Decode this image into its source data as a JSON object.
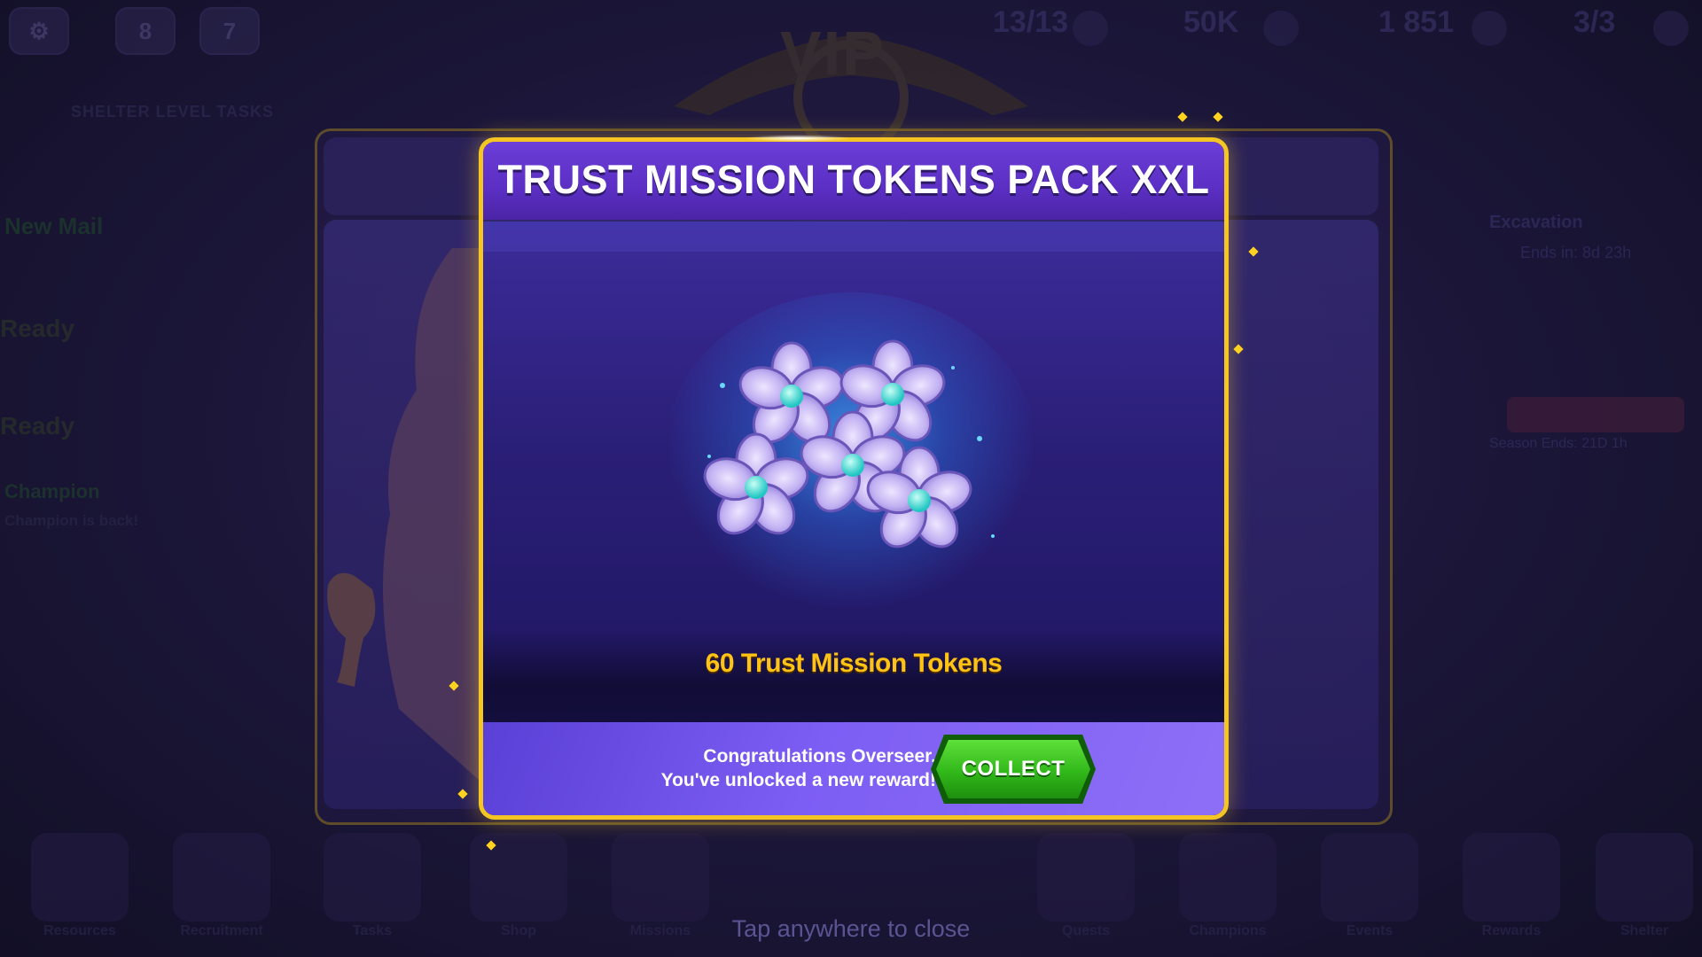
{
  "topbar": {
    "badge_a": "8",
    "badge_b": "7",
    "energy": "13/13",
    "caps": "50K",
    "gems": "1 851",
    "tickets": "3/3"
  },
  "vip": {
    "label": "VIP"
  },
  "left_panel": {
    "title": "SHELTER LEVEL TASKS",
    "new_mail": "New Mail",
    "ready_1": "Ready",
    "ready_2": "Ready",
    "champion": "Champion",
    "champion_sub": "Champion is back!"
  },
  "right_panel": {
    "title": "Excavation",
    "ends_in": "Ends in: 8d 23h",
    "season_ends": "Season Ends: 21D 1h"
  },
  "modal": {
    "title": "TRUST MISSION TOKENS PACK XXL",
    "reward_amount": "60 Trust Mission Tokens",
    "congrats_line1": "Congratulations Overseer,",
    "congrats_line2": "You've unlocked a new reward!",
    "collect_label": "COLLECT",
    "reward_icon": "flower-token-icon"
  },
  "bottom_nav": {
    "items": [
      "Resources",
      "Recruitment",
      "Tasks",
      "Shop",
      "Missions",
      "Quests",
      "Champions",
      "Events",
      "Rewards",
      "Shelter"
    ]
  },
  "close_hint": "Tap anywhere to close",
  "colors": {
    "accent_gold": "#f5c623",
    "reward_text": "#ffc315",
    "collect_green": "#31b81a",
    "modal_purple": "#5b2fc3"
  }
}
